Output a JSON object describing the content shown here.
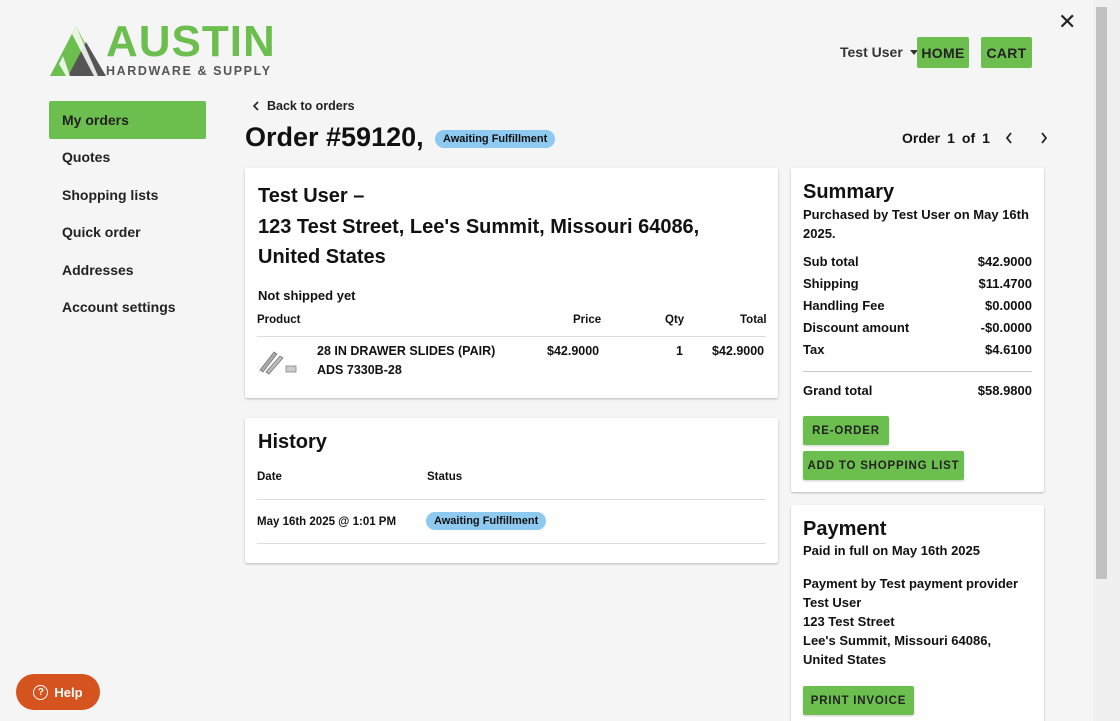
{
  "logo": {
    "brand": "AUSTIN",
    "tagline": "HARDWARE & SUPPLY",
    "icon": "austin-mountain-logo"
  },
  "header": {
    "user": "Test User",
    "home_label": "HOME",
    "cart_label": "CART",
    "close_icon": "close-icon"
  },
  "sidebar": {
    "items": [
      {
        "label": "My orders",
        "active": true
      },
      {
        "label": "Quotes"
      },
      {
        "label": "Shopping lists"
      },
      {
        "label": "Quick order"
      },
      {
        "label": "Addresses"
      },
      {
        "label": "Account settings"
      }
    ]
  },
  "order": {
    "back_label": "Back to orders",
    "title": "Order #59120,",
    "status": "Awaiting Fulfillment",
    "pager": {
      "label": "Order",
      "current": "1",
      "of": "of",
      "total": "1"
    }
  },
  "shipment": {
    "name": "Test User –",
    "address": "123 Test Street, Lee's Summit, Missouri 64086, United States",
    "ship_status": "Not shipped yet",
    "columns": {
      "product": "Product",
      "price": "Price",
      "qty": "Qty",
      "total": "Total"
    },
    "items": [
      {
        "name": "28 IN DRAWER SLIDES (PAIR)",
        "sku": "ADS 7330B-28",
        "price": "$42.9000",
        "qty": "1",
        "total": "$42.9000"
      }
    ]
  },
  "history": {
    "title": "History",
    "columns": {
      "date": "Date",
      "status": "Status"
    },
    "rows": [
      {
        "date": "May 16th 2025 @ 1:01 PM",
        "status": "Awaiting Fulfillment"
      }
    ]
  },
  "summary": {
    "title": "Summary",
    "purchased_by": "Purchased by Test User on May 16th 2025.",
    "lines": [
      {
        "label": "Sub total",
        "value": "$42.9000"
      },
      {
        "label": "Shipping",
        "value": "$11.4700"
      },
      {
        "label": "Handling Fee",
        "value": "$0.0000"
      },
      {
        "label": "Discount amount",
        "value": "-$0.0000"
      },
      {
        "label": "Tax",
        "value": "$4.6100"
      }
    ],
    "grand_total_label": "Grand total",
    "grand_total_value": "$58.9800",
    "reorder_label": "RE-ORDER",
    "add_list_label": "ADD TO SHOPPING LIST"
  },
  "payment": {
    "title": "Payment",
    "paid_status": "Paid in full on May 16th 2025",
    "provider_line": "Payment by Test payment provider",
    "name": "Test User",
    "street": "123 Test Street",
    "city_line": "Lee's Summit, Missouri 64086, United States",
    "print_label": "PRINT INVOICE"
  },
  "help": {
    "label": "Help"
  },
  "colors": {
    "accent": "#6cbf4e",
    "badge": "#8ec9f0",
    "help": "#d4531f"
  }
}
